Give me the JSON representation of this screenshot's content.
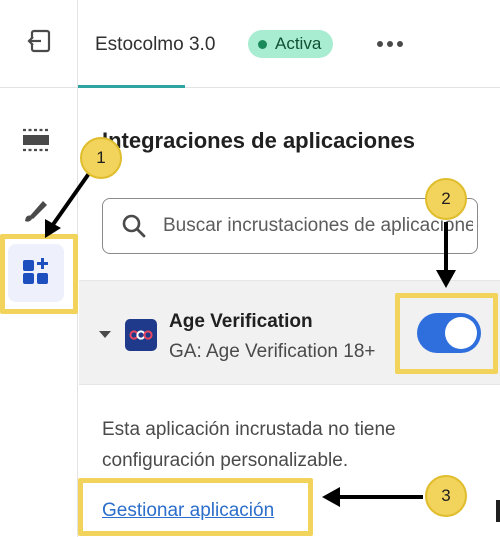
{
  "header": {
    "theme_name": "Estocolmo 3.0",
    "status_badge": "Activa",
    "more_icon": "ellipsis-icon"
  },
  "sidebar": {
    "items": [
      {
        "icon": "exit-icon"
      },
      {
        "icon": "sections-icon"
      },
      {
        "icon": "paintbrush-icon"
      },
      {
        "icon": "app-embeds-icon",
        "selected": true
      }
    ]
  },
  "main": {
    "title": "Integraciones de aplicaciones",
    "search": {
      "placeholder": "Buscar incrustaciones de aplicaciones",
      "value": ""
    },
    "app_embed": {
      "name": "Age Verification",
      "subtitle": "GA: Age Verification 18+",
      "enabled": true,
      "note": "Esta aplicación incrustada no tiene configuración personalizable.",
      "manage_link": "Gestionar aplicación"
    }
  },
  "annotations": {
    "markers": [
      "1",
      "2",
      "3"
    ],
    "highlight_color": "#f2d35c"
  },
  "colors": {
    "accent_teal": "#2fa3a0",
    "badge_bg": "#a8ecd1",
    "toggle_on": "#2f6fdd",
    "link": "#2c6ecb"
  }
}
